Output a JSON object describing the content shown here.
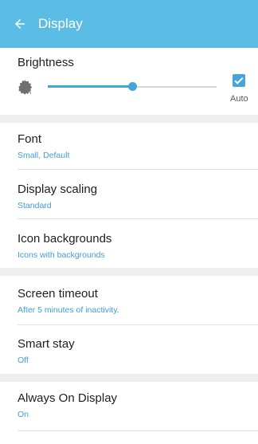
{
  "app_bar": {
    "title": "Display",
    "back_icon": "arrow-left-icon",
    "color": "#5bbde6"
  },
  "brightness": {
    "title": "Brightness",
    "level": 0.5,
    "auto_label": "Auto",
    "auto_checked": true,
    "icon": "auto-brightness-icon",
    "accent_color": "#42a6db"
  },
  "settings": [
    {
      "title": "Font",
      "subtitle": "Small, Default"
    },
    {
      "title": "Display scaling",
      "subtitle": "Standard"
    },
    {
      "title": "Icon backgrounds",
      "subtitle": "Icons with backgrounds"
    },
    {
      "title": "Screen timeout",
      "subtitle": "After 5 minutes of inactivity."
    },
    {
      "title": "Smart stay",
      "subtitle": "Off"
    },
    {
      "title": "Always On Display",
      "subtitle": "On"
    }
  ]
}
